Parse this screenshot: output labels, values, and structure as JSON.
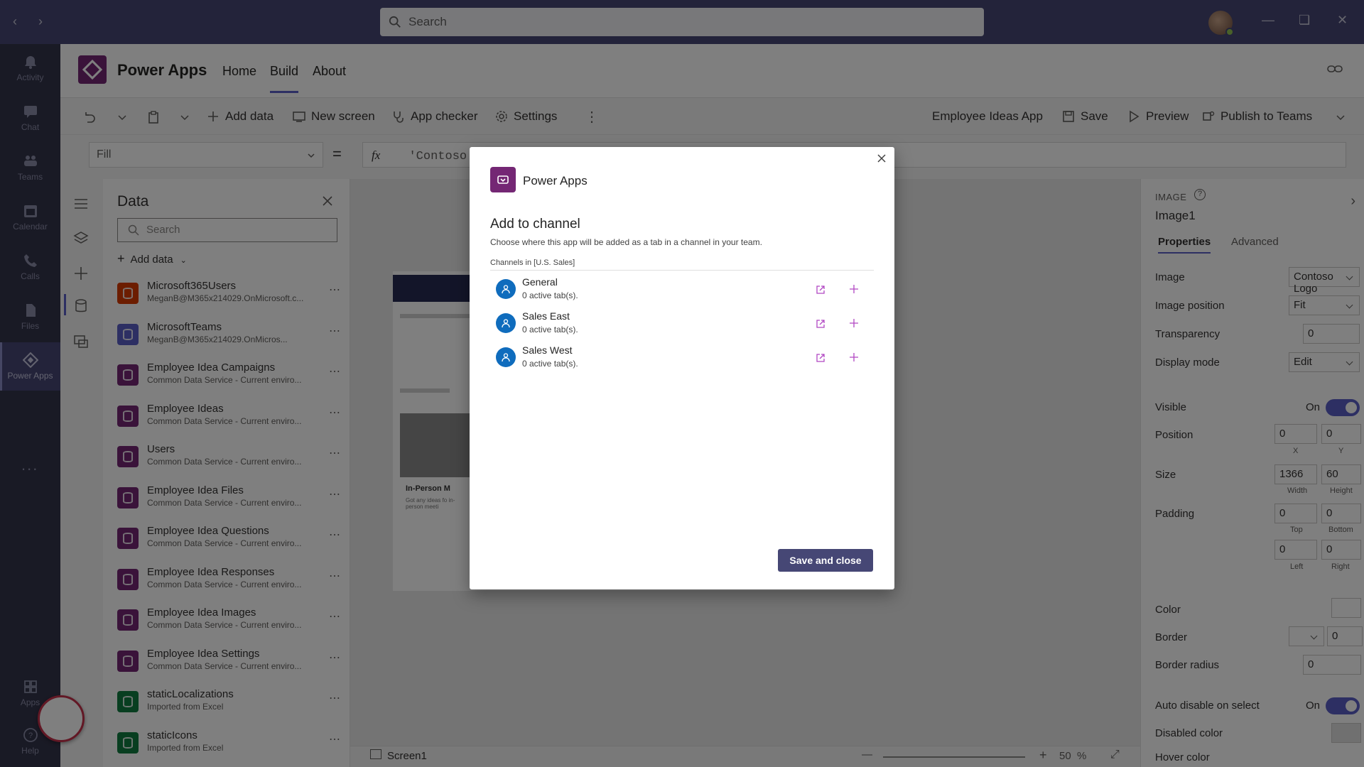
{
  "titlebar": {
    "search_placeholder": "Search"
  },
  "rail": {
    "items": [
      {
        "label": "Activity"
      },
      {
        "label": "Chat"
      },
      {
        "label": "Teams"
      },
      {
        "label": "Calendar"
      },
      {
        "label": "Calls"
      },
      {
        "label": "Files"
      },
      {
        "label": "Power Apps"
      }
    ],
    "more": "...",
    "apps_label": "Apps",
    "help_label": "Help"
  },
  "app_header": {
    "title": "Power Apps",
    "tabs": [
      "Home",
      "Build",
      "About"
    ],
    "selected_tab": "Build"
  },
  "toolbar": {
    "add_data": "Add data",
    "new_screen": "New screen",
    "app_checker": "App checker",
    "settings": "Settings",
    "app_name": "Employee Ideas App",
    "save": "Save",
    "preview": "Preview",
    "publish": "Publish to Teams"
  },
  "formula": {
    "property": "Fill",
    "eq": "=",
    "fx": "fx",
    "expression": "'Contoso"
  },
  "data_pane": {
    "title": "Data",
    "search_placeholder": "Search",
    "add_data": "Add data",
    "sources": [
      {
        "name": "Microsoft365Users",
        "sub": "MeganB@M365x214029.OnMicrosoft.c...",
        "color": "#d83b01"
      },
      {
        "name": "MicrosoftTeams",
        "sub": "MeganB@M365x214029.OnMicros...",
        "color": "#5b5fc7"
      },
      {
        "name": "Employee Idea Campaigns",
        "sub": "Common Data Service - Current enviro...",
        "color": "#742774"
      },
      {
        "name": "Employee Ideas",
        "sub": "Common Data Service - Current enviro...",
        "color": "#742774"
      },
      {
        "name": "Users",
        "sub": "Common Data Service - Current enviro...",
        "color": "#742774"
      },
      {
        "name": "Employee Idea Files",
        "sub": "Common Data Service - Current enviro...",
        "color": "#742774"
      },
      {
        "name": "Employee Idea Questions",
        "sub": "Common Data Service - Current enviro...",
        "color": "#742774"
      },
      {
        "name": "Employee Idea Responses",
        "sub": "Common Data Service - Current enviro...",
        "color": "#742774"
      },
      {
        "name": "Employee Idea Images",
        "sub": "Common Data Service - Current enviro...",
        "color": "#742774"
      },
      {
        "name": "Employee Idea Settings",
        "sub": "Common Data Service - Current enviro...",
        "color": "#742774"
      },
      {
        "name": "staticLocalizations",
        "sub": "Imported from Excel",
        "color": "#107c41"
      },
      {
        "name": "staticIcons",
        "sub": "Imported from Excel",
        "color": "#107c41"
      }
    ]
  },
  "canvas": {
    "screen_name": "Screen1",
    "zoom": "50",
    "zoom_unit": "%",
    "card_title": "In-Person M",
    "card_text": "Got any ideas fo in-person meeti"
  },
  "props": {
    "caption": "IMAGE",
    "control_name": "Image1",
    "tabs": [
      "Properties",
      "Advanced"
    ],
    "image_label": "Image",
    "image_value": "Contoso Logo",
    "image_position_label": "Image position",
    "image_position_value": "Fit",
    "transparency_label": "Transparency",
    "transparency_value": "0",
    "display_mode_label": "Display mode",
    "display_mode_value": "Edit",
    "visible_label": "Visible",
    "on": "On",
    "position_label": "Position",
    "pos_x": "0",
    "pos_y": "0",
    "x": "X",
    "y": "Y",
    "size_label": "Size",
    "width": "1366",
    "height": "60",
    "width_lbl": "Width",
    "height_lbl": "Height",
    "padding_label": "Padding",
    "pad_top": "0",
    "pad_bottom": "0",
    "pad_left": "0",
    "pad_right": "0",
    "top_lbl": "Top",
    "bottom_lbl": "Bottom",
    "left_lbl": "Left",
    "right_lbl": "Right",
    "color_label": "Color",
    "border_label": "Border",
    "border_value": "0",
    "border_radius_label": "Border radius",
    "border_radius_value": "0",
    "auto_disable_label": "Auto disable on select",
    "disabled_color_label": "Disabled color",
    "hover_color_label": "Hover color"
  },
  "dialog": {
    "app_name": "Power Apps",
    "heading": "Add to channel",
    "description": "Choose where this app will be added as a tab in a channel in your team.",
    "channels_caption": "Channels in [U.S. Sales]",
    "channels": [
      {
        "name": "General",
        "tabs": "0 active tab(s)."
      },
      {
        "name": "Sales East",
        "tabs": "0 active tab(s)."
      },
      {
        "name": "Sales West",
        "tabs": "0 active tab(s)."
      }
    ],
    "save_button": "Save and close"
  },
  "colors": {
    "teams_purple": "#464775",
    "rail_bg": "#33344a",
    "power_apps_brand": "#742774",
    "channel_avatar": "#0f6cbd",
    "accent": "#5b5fc7"
  }
}
